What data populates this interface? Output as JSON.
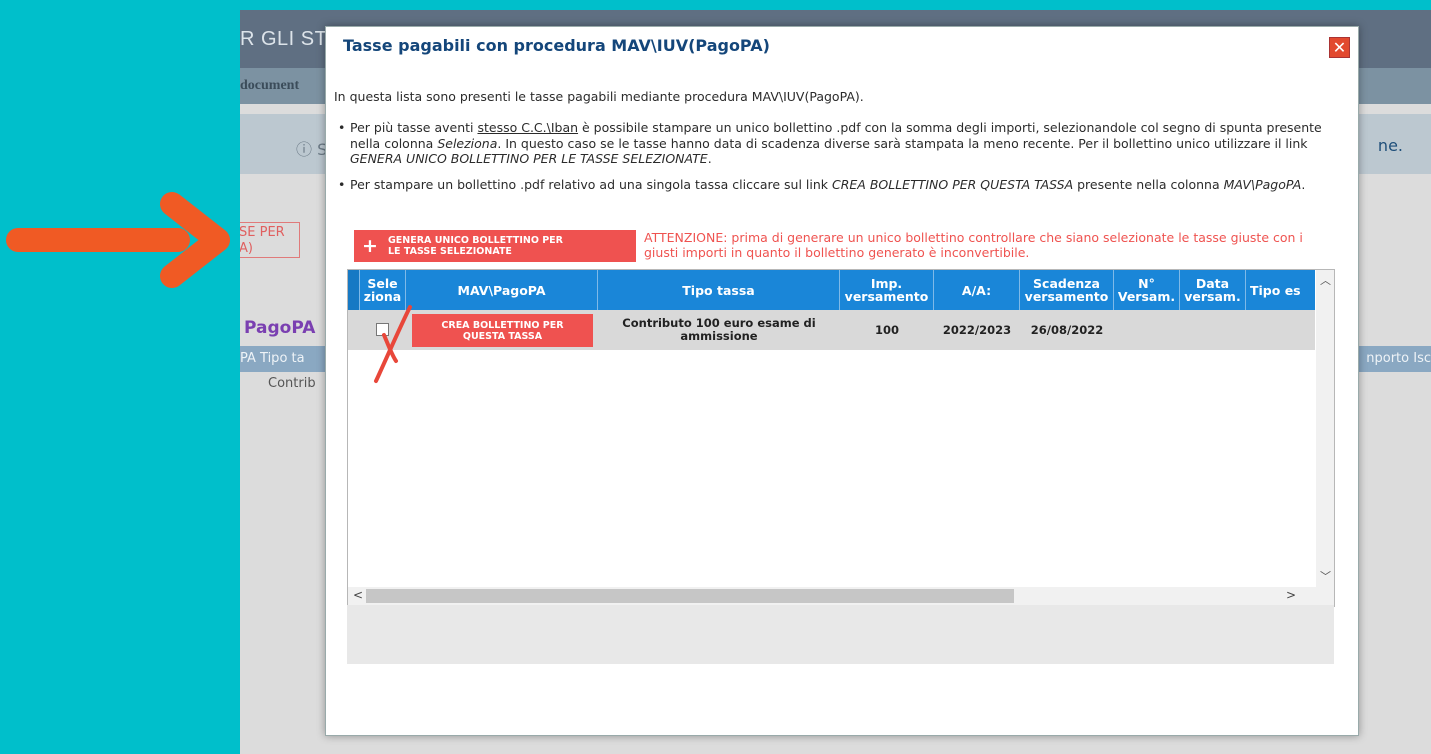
{
  "background": {
    "title": "R GLI STU",
    "menu_text": "document",
    "band_icon": "ⓘ S",
    "band_right": "ne.",
    "redbox_line1": "SE PER",
    "redbox_line2": "A)",
    "pagopa": "PagoPA",
    "th_left": "PA  Tipo ta",
    "th_right": "nporto Isc",
    "cell": "Contrib"
  },
  "modal": {
    "title": "Tasse pagabili con procedura MAV\\IUV(PagoPA)",
    "close_icon": "close-icon",
    "intro": "In questa lista sono presenti le tasse pagabili mediante procedura MAV\\IUV(PagoPA).",
    "bullet1": {
      "t1": "Per più tasse aventi ",
      "link": "stesso C.C.\\Iban",
      "t2": " è possibile stampare un unico bollettino .pdf con la somma degli importi, selezionandole col segno di spunta presente nella colonna ",
      "t3": "Seleziona",
      "t4": ". In questo caso se le tasse hanno data di scadenza diverse sarà stampata la meno recente. Per il bollettino unico utilizzare il link ",
      "t5": "GENERA UNICO BOLLETTINO PER LE TASSE SELEZIONATE",
      "t6": "."
    },
    "bullet2": {
      "t1": "Per stampare un bollettino .pdf relativo ad una singola tassa cliccare sul link ",
      "t2": "CREA BOLLETTINO PER QUESTA TASSA",
      "t3": " presente nella colonna ",
      "t4": "MAV\\PagoPA",
      "t5": "."
    },
    "generate_button": {
      "line1": "GENERA UNICO BOLLETTINO PER",
      "line2": "LE TASSE SELEZIONATE"
    },
    "warning": "ATTENZIONE: prima di generare un unico bollettino controllare che siano selezionate le tasse giuste con i giusti importi in quanto il bollettino generato è inconvertibile.",
    "table": {
      "headers": [
        "Sele ziona",
        "MAV\\PagoPA",
        "Tipo tassa",
        "Imp. versamento",
        "A/A:",
        "Scadenza versamento",
        "N° Versam.",
        "Data versam.",
        "Tipo es"
      ],
      "row": {
        "button_line1": "CREA BOLLETTINO PER",
        "button_line2": "QUESTA TASSA",
        "tipo": "Contributo 100 euro esame di ammissione",
        "imp": "100",
        "aa": "2022/2023",
        "scadenza": "26/08/2022",
        "n": "",
        "data": "",
        "tipo_es": ""
      }
    }
  },
  "colors": {
    "background": "#00bfcb",
    "arrow": "#f05a24",
    "header_blue": "#1a86d8",
    "button_red": "#ef5250",
    "title_blue": "#14467a"
  }
}
